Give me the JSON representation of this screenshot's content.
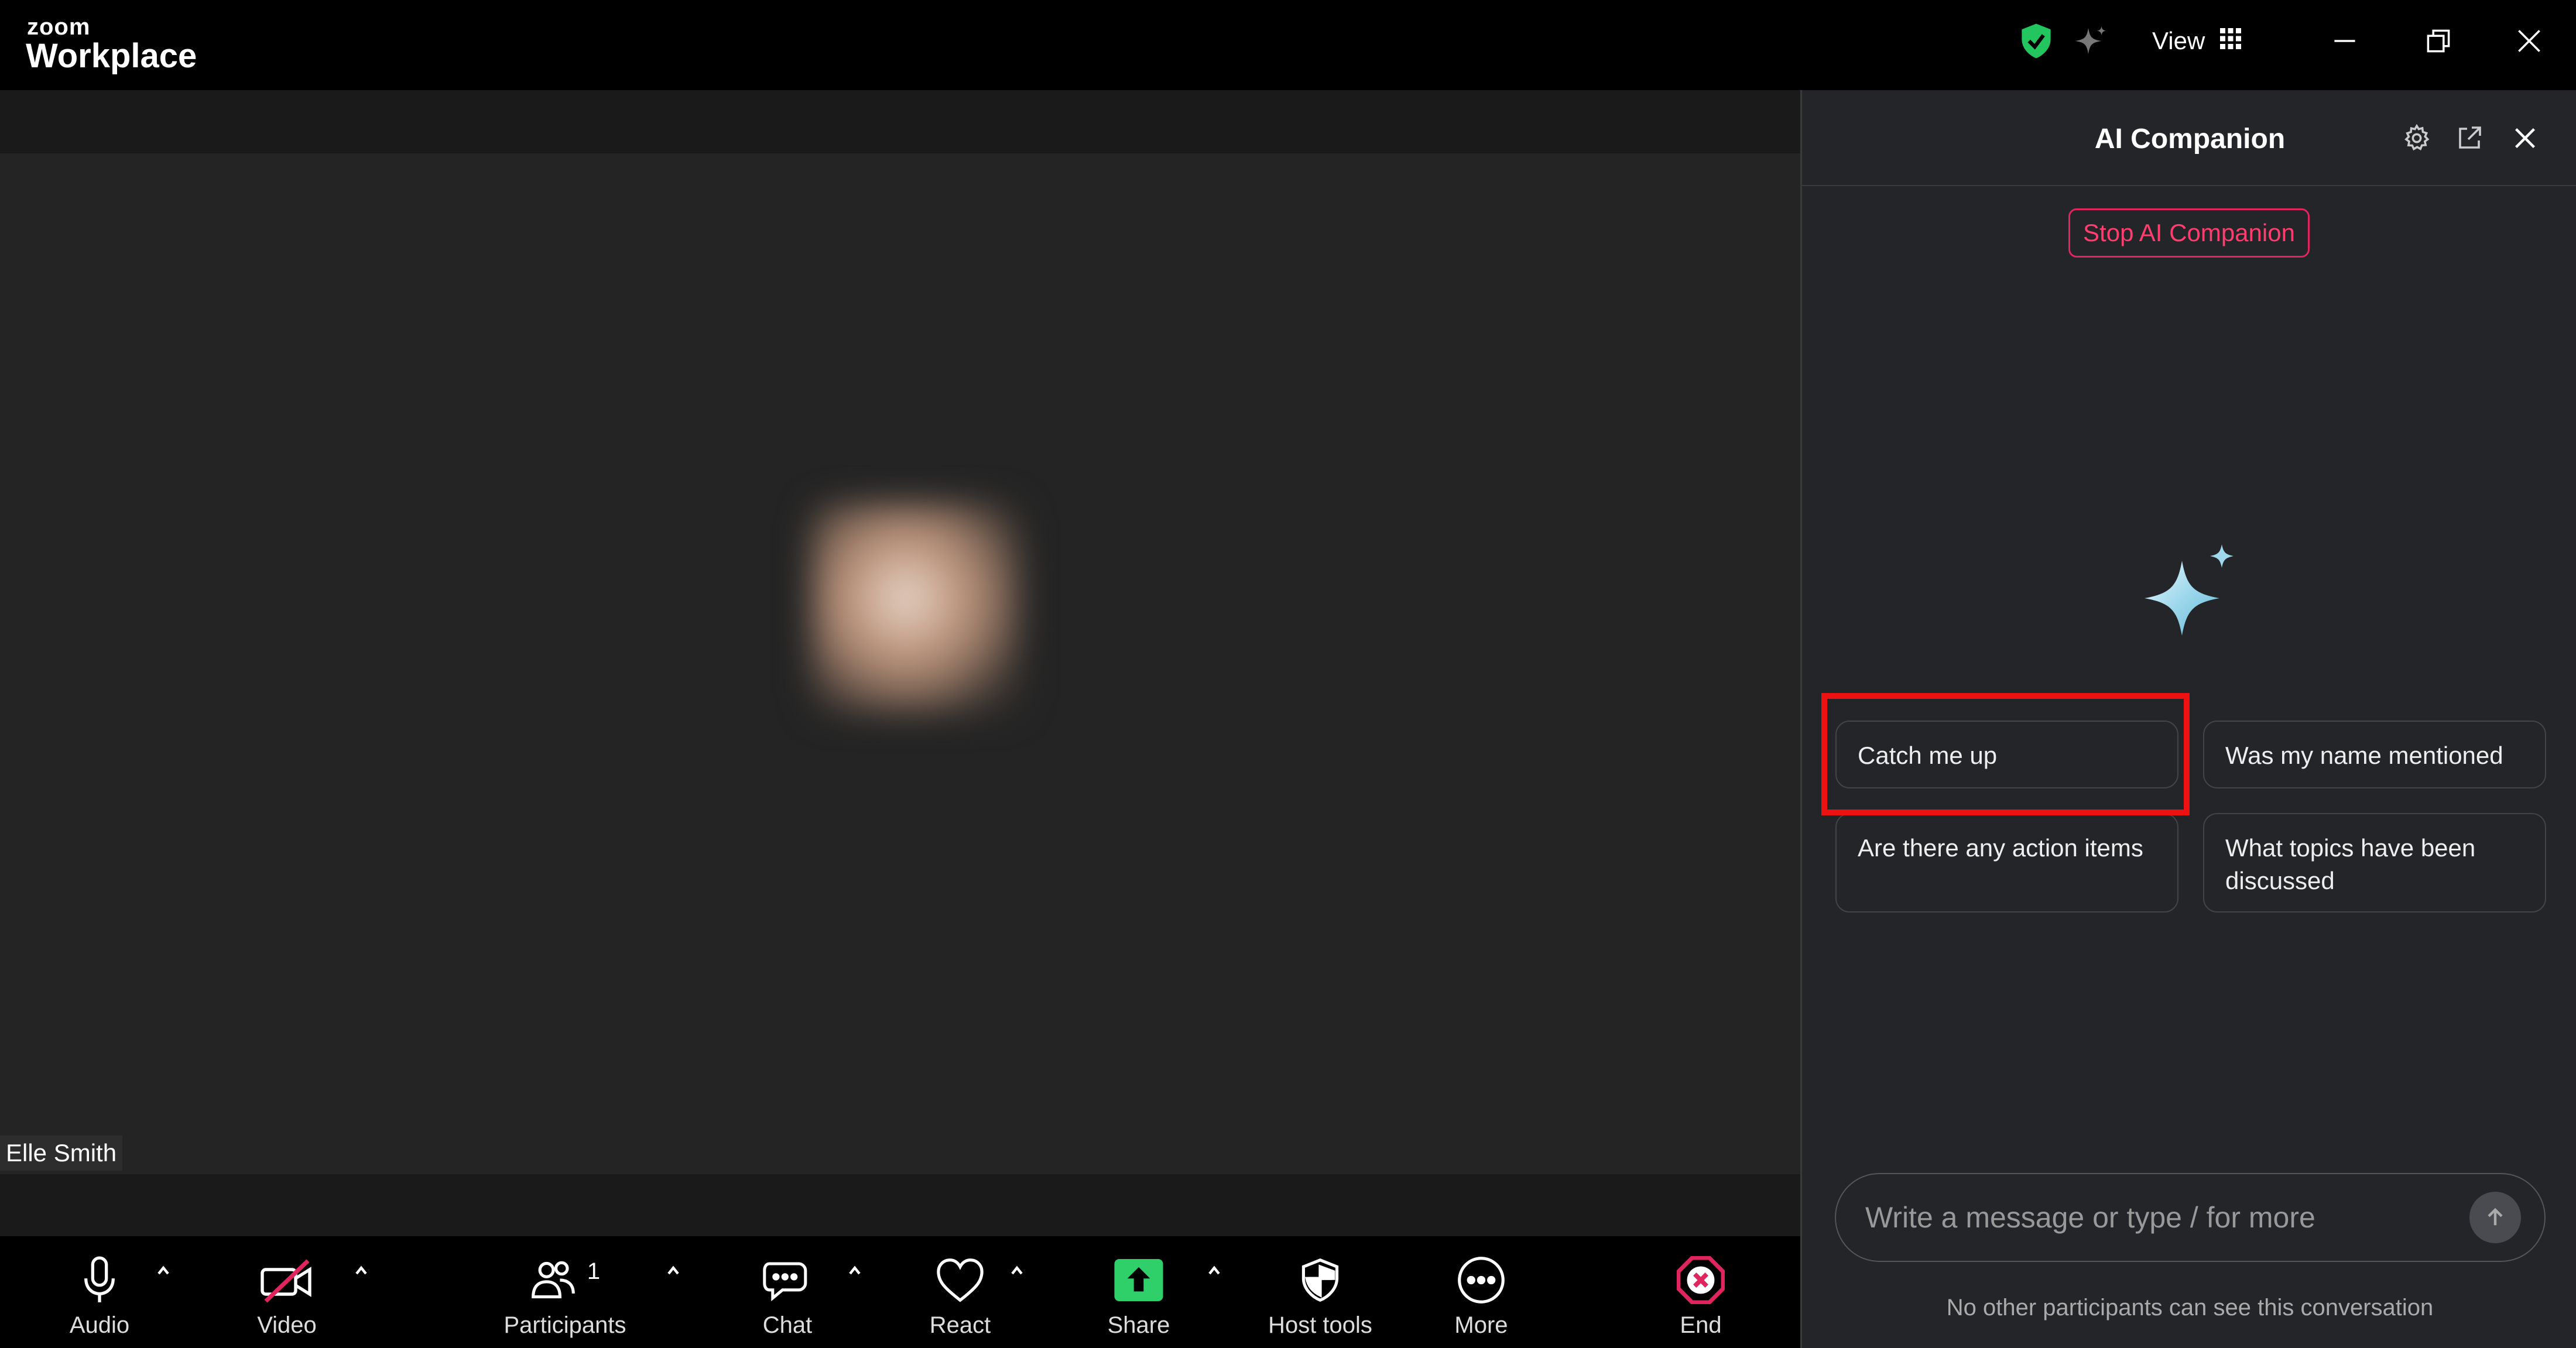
{
  "app": {
    "brand_small": "zoom",
    "brand_big": "Workplace",
    "view_label": "View"
  },
  "meeting": {
    "participant_name": "Elle Smith"
  },
  "toolbar": {
    "audio": "Audio",
    "video": "Video",
    "participants": "Participants",
    "participants_count": "1",
    "chat": "Chat",
    "react": "React",
    "share": "Share",
    "host_tools": "Host tools",
    "more": "More",
    "end": "End"
  },
  "panel": {
    "title": "AI Companion",
    "stop_button": "Stop AI Companion",
    "suggestions": [
      "Catch me up",
      "Was my name mentioned",
      "Are there any action items",
      "What topics have been discussed"
    ],
    "input_placeholder": "Write a message or type / for more",
    "footer_note": "No other participants can see this conversation"
  },
  "colors": {
    "accent_red": "#e0245e",
    "shield_green": "#22c55e",
    "share_green": "#2fd06a"
  }
}
